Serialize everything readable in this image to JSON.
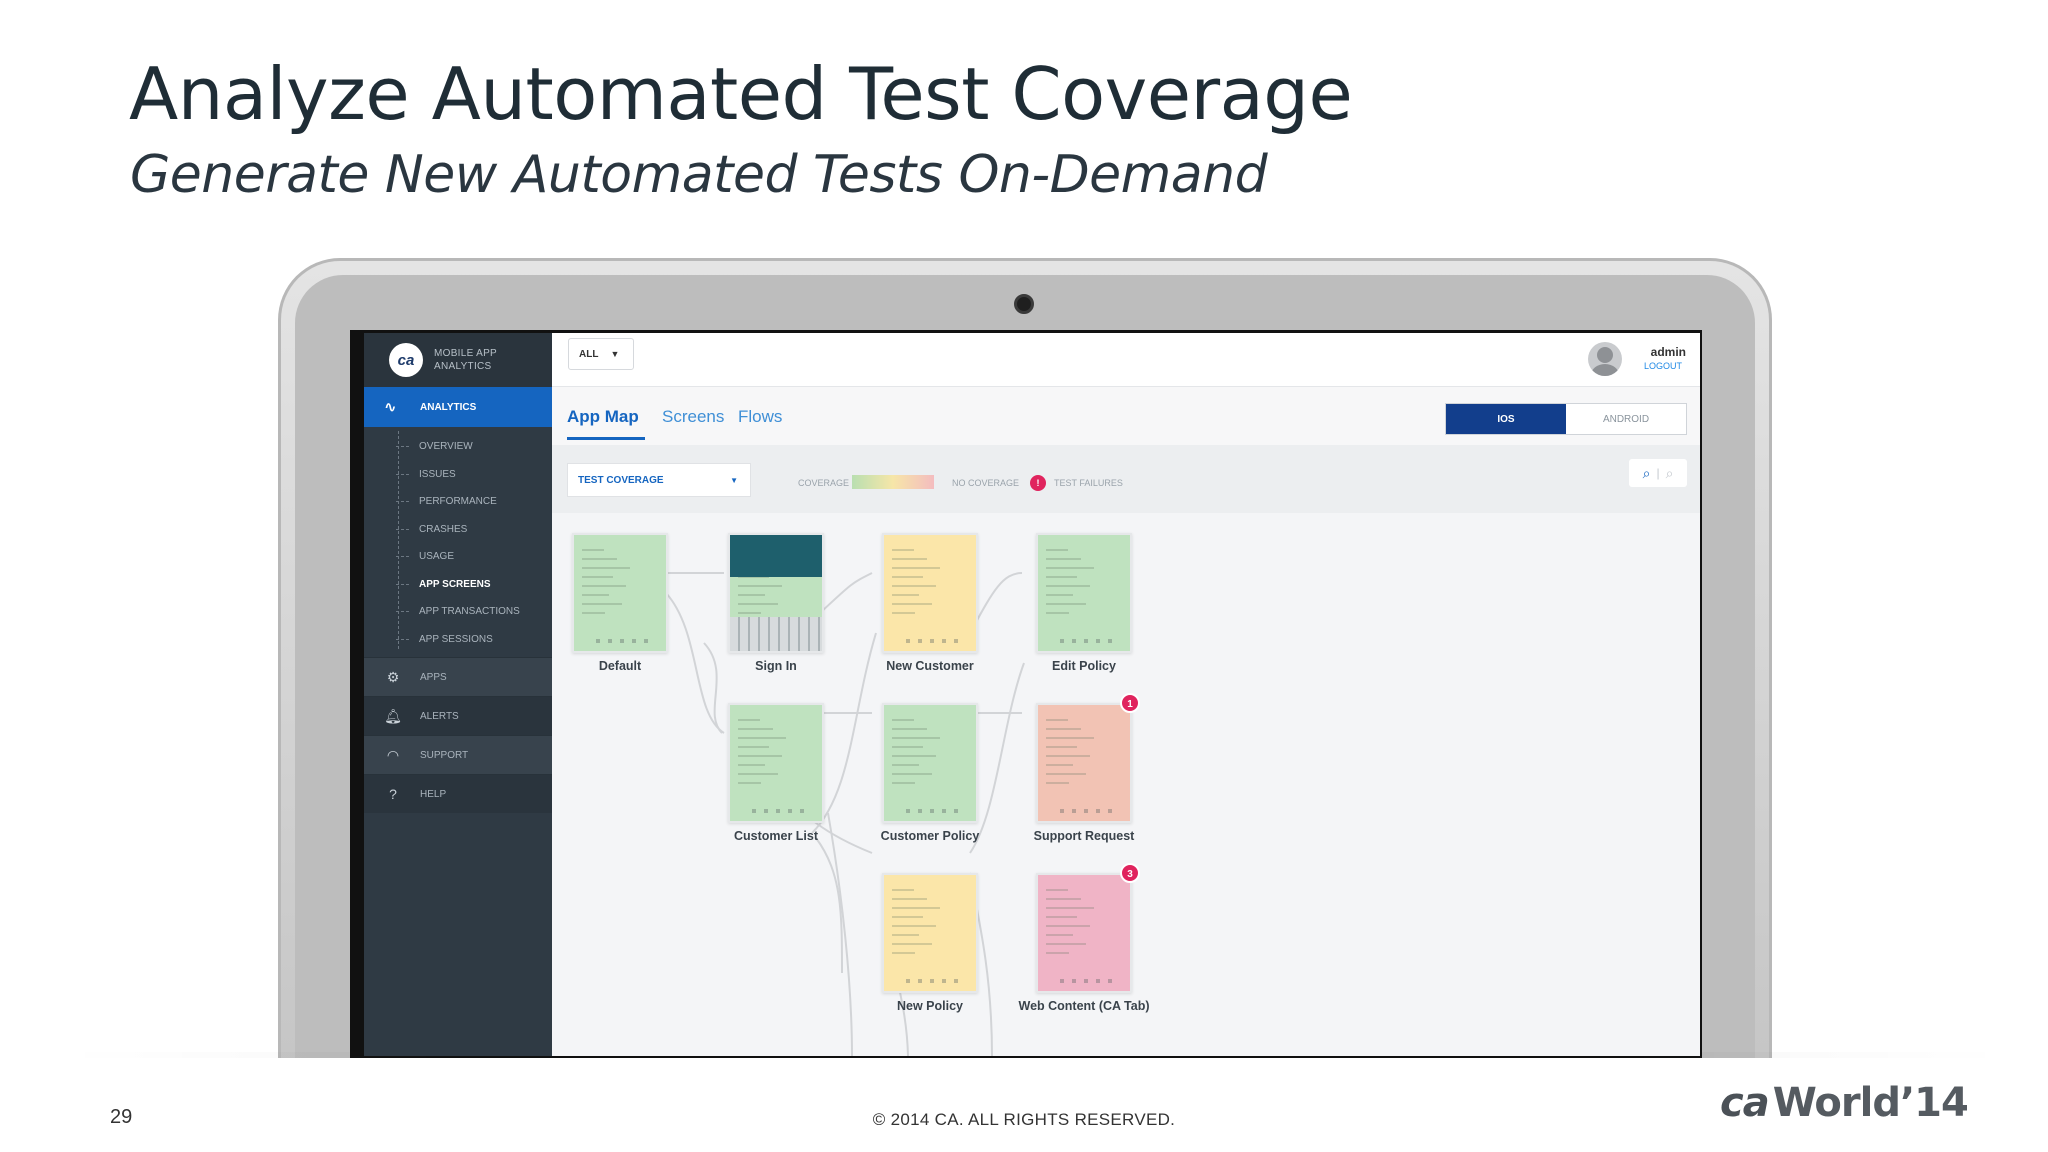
{
  "slide": {
    "title": "Analyze Automated Test Coverage",
    "subtitle": "Generate New Automated Tests On-Demand",
    "page_number": "29",
    "copyright": "© 2014 CA. ALL RIGHTS RESERVED.",
    "brand_ca": "ca",
    "brand_rest": "World’14"
  },
  "app": {
    "logo_text": "ca",
    "logo_line1": "MOBILE APP",
    "logo_line2": "ANALYTICS",
    "app_filter": "ALL",
    "user_name": "admin",
    "logout": "LOGOUT"
  },
  "sidebar": {
    "active": "ANALYTICS",
    "subitems": [
      "OVERVIEW",
      "ISSUES",
      "PERFORMANCE",
      "CRASHES",
      "USAGE",
      "APP SCREENS",
      "APP TRANSACTIONS",
      "APP SESSIONS"
    ],
    "current_subitem": "APP SCREENS",
    "items": [
      "APPS",
      "ALERTS",
      "SUPPORT",
      "HELP"
    ]
  },
  "tabs": [
    "App Map",
    "Screens",
    "Flows"
  ],
  "os_toggle": [
    "IOS",
    "ANDROID"
  ],
  "filter": {
    "select": "TEST COVERAGE",
    "coverage": "COVERAGE",
    "no_coverage": "NO COVERAGE",
    "failure_count": "!",
    "failures": "TEST FAILURES"
  },
  "screens": [
    {
      "label": "Default",
      "coverage": "covered"
    },
    {
      "label": "Sign In",
      "coverage": "covered"
    },
    {
      "label": "New Customer",
      "coverage": "partial"
    },
    {
      "label": "Edit Policy",
      "coverage": "covered"
    },
    {
      "label": "Customer List",
      "coverage": "covered"
    },
    {
      "label": "Customer Policy",
      "coverage": "covered"
    },
    {
      "label": "Support Request",
      "coverage": "failing",
      "failures": "1"
    },
    {
      "label": "New Policy",
      "coverage": "partial"
    },
    {
      "label": "Web Content (CA Tab)",
      "coverage": "failing",
      "failures": "3"
    }
  ],
  "colors": {
    "accent": "#1565c0",
    "sidebar": "#2f3a44",
    "covered": "#bfe2bf",
    "partial": "#fbe6a9",
    "failing": "#f2c3b4",
    "failure_badge": "#e0245e"
  }
}
